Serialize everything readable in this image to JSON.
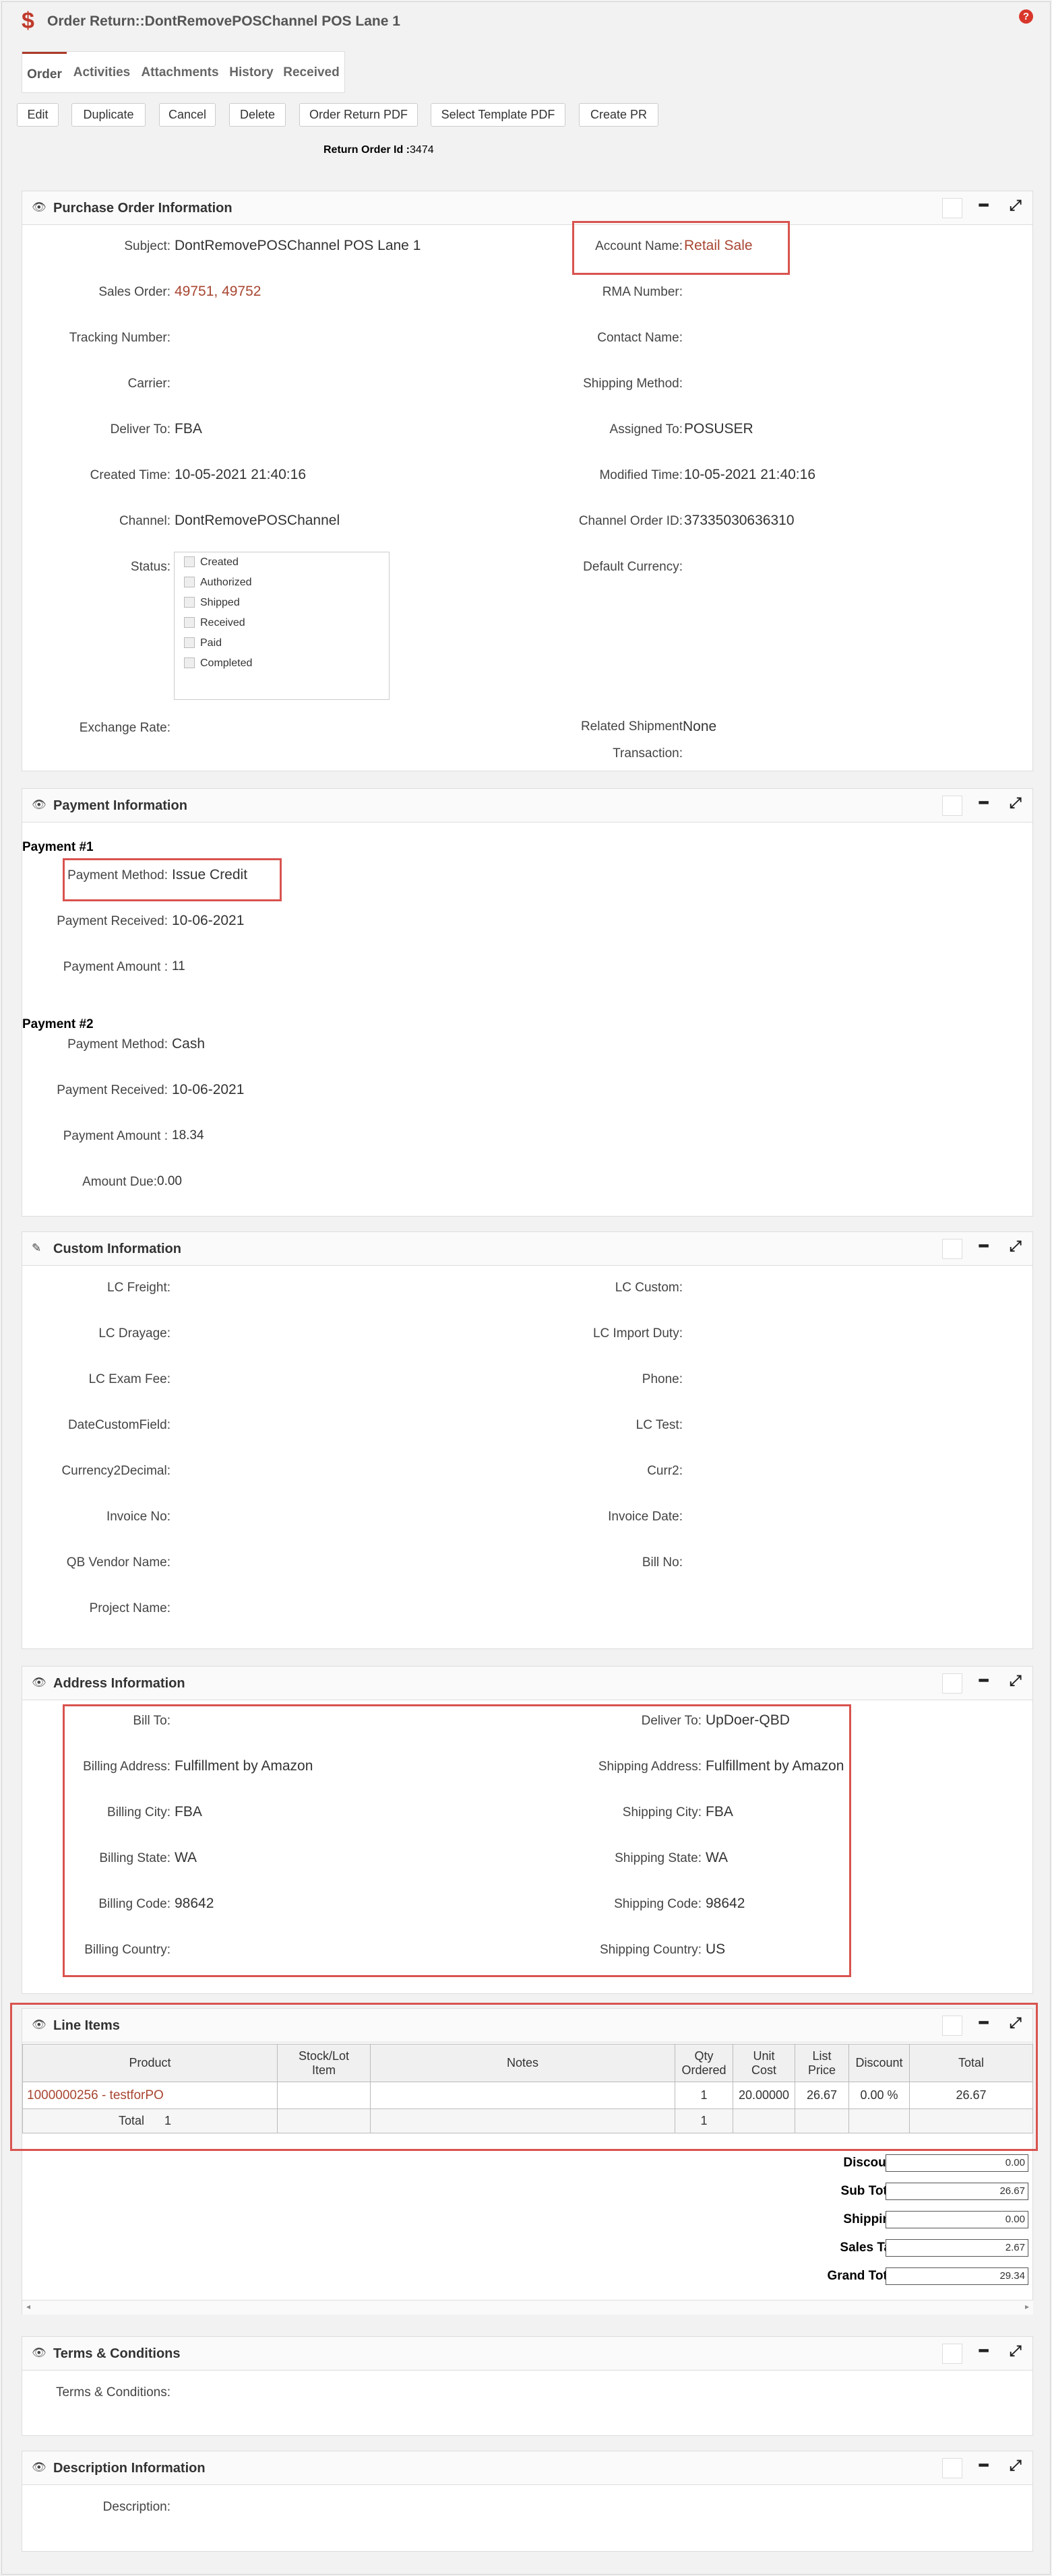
{
  "header": {
    "title": "Order Return::DontRemovePOSChannel POS Lane 1",
    "icon": "dollar-icon",
    "help_icon": "help-icon",
    "help": "?"
  },
  "tabs": [
    "Order",
    "Activities",
    "Attachments",
    "History",
    "Received"
  ],
  "toolbar": [
    "Edit",
    "Duplicate",
    "Cancel",
    "Delete",
    "Order Return PDF",
    "Select Template PDF",
    "Create PR"
  ],
  "return_id": {
    "label": "Return Order Id :",
    "value": "3474"
  },
  "purchase": {
    "title": "Purchase Order Information",
    "subject_label": "Subject:",
    "subject": "DontRemovePOSChannel POS Lane 1",
    "account_label": "Account Name:",
    "account": "Retail Sale",
    "sales_order_label": "Sales Order:",
    "sales_order": "49751, 49752",
    "rma_label": "RMA Number:",
    "tracking_label": "Tracking Number:",
    "contact_label": "Contact Name:",
    "carrier_label": "Carrier:",
    "shipping_method_label": "Shipping Method:",
    "deliver_label": "Deliver To:",
    "deliver": "FBA",
    "assigned_label": "Assigned To:",
    "assigned": "POSUSER",
    "created_label": "Created Time:",
    "created": "10-05-2021 21:40:16",
    "modified_label": "Modified Time:",
    "modified": "10-05-2021 21:40:16",
    "channel_label": "Channel:",
    "channel": "DontRemovePOSChannel",
    "channel_order_label": "Channel Order ID:",
    "channel_order": "37335030636310",
    "status_label": "Status:",
    "currency_label": "Default Currency:",
    "statuses": [
      "Created",
      "Authorized",
      "Shipped",
      "Received",
      "Paid",
      "Completed"
    ],
    "exchange_label": "Exchange Rate:",
    "related_label": "Related Shipment",
    "related_value": "None",
    "transaction_label": "Transaction:"
  },
  "payment": {
    "title": "Payment Information",
    "p1": {
      "heading": "Payment #1",
      "method_label": "Payment Method:",
      "method": "Issue Credit",
      "received_label": "Payment Received:",
      "received": "10-06-2021",
      "amount_label": "Payment Amount :",
      "amount": "11"
    },
    "p2": {
      "heading": "Payment #2",
      "method_label": "Payment Method:",
      "method": "Cash",
      "received_label": "Payment Received:",
      "received": "10-06-2021",
      "amount_label": "Payment Amount :",
      "amount": "18.34"
    },
    "due_label": "Amount Due:",
    "due": "0.00"
  },
  "custom": {
    "title": "Custom Information",
    "left": [
      "LC Freight:",
      "LC Drayage:",
      "LC Exam Fee:",
      "DateCustomField:",
      "Currency2Decimal:",
      "Invoice No:",
      "QB Vendor Name:",
      "Project Name:"
    ],
    "right": [
      "LC Custom:",
      "LC Import Duty:",
      "Phone:",
      "LC Test:",
      "Curr2:",
      "Invoice Date:",
      "Bill No:"
    ]
  },
  "address": {
    "title": "Address Information",
    "left": [
      [
        "Bill To:",
        ""
      ],
      [
        "Billing Address:",
        "Fulfillment by Amazon"
      ],
      [
        "Billing City:",
        "FBA"
      ],
      [
        "Billing State:",
        "WA"
      ],
      [
        "Billing Code:",
        "98642"
      ],
      [
        "Billing Country:",
        ""
      ]
    ],
    "right": [
      [
        "Deliver To:",
        "UpDoer-QBD"
      ],
      [
        "Shipping Address:",
        "Fulfillment by Amazon"
      ],
      [
        "Shipping City:",
        "FBA"
      ],
      [
        "Shipping State:",
        "WA"
      ],
      [
        "Shipping Code:",
        "98642"
      ],
      [
        "Shipping Country:",
        "US"
      ]
    ]
  },
  "lineitems": {
    "title": "Line Items",
    "headers": [
      "Product",
      "Stock/Lot\nItem",
      "Notes",
      "Qty\nOrdered",
      "Unit\nCost",
      "List\nPrice",
      "Discount",
      "Total"
    ],
    "row": {
      "product": "1000000256 - testforPO",
      "stock": "",
      "notes": "",
      "qty": "1",
      "unit": "20.00000",
      "list": "26.67",
      "discount": "0.00 %",
      "total": "26.67"
    },
    "total_label": "Total",
    "total_count": "1",
    "total_qty": "1"
  },
  "totals": [
    [
      "Discount:",
      "0.00"
    ],
    [
      "Sub Total:",
      "26.67"
    ],
    [
      "Shipping:",
      "0.00"
    ],
    [
      "Sales Tax:",
      "2.67"
    ],
    [
      "Grand Total:",
      "29.34"
    ]
  ],
  "terms": {
    "title": "Terms & Conditions",
    "label": "Terms & Conditions:"
  },
  "description": {
    "title": "Description Information",
    "label": "Description:"
  }
}
